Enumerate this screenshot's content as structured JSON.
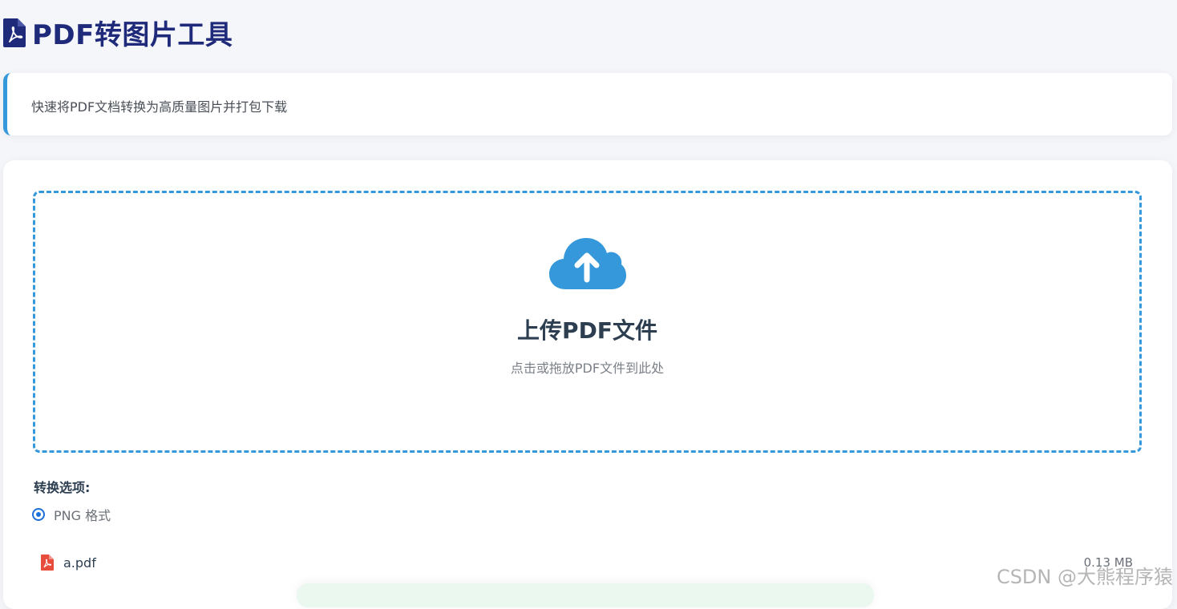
{
  "header": {
    "icon": "pdf-file-icon",
    "title": "PDF转图片工具"
  },
  "description": {
    "text": "快速将PDF文档转换为高质量图片并打包下载",
    "accent_color": "#3498db"
  },
  "upload": {
    "icon": "cloud-upload-icon",
    "title": "上传PDF文件",
    "hint": "点击或拖放PDF文件到此处",
    "border_color": "#3498db"
  },
  "options": {
    "title": "转换选项:",
    "items": [
      {
        "label": "PNG 格式",
        "selected": true
      }
    ]
  },
  "files": [
    {
      "icon": "pdf-file-icon",
      "name": "a.pdf",
      "size": "0.13 MB"
    }
  ],
  "watermark": "CSDN @大熊程序猿"
}
